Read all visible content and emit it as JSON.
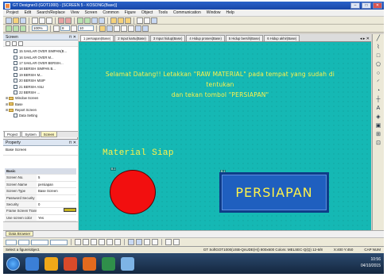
{
  "window": {
    "title": "GT Designer3 (GOT1000) - [SCREEN 5 - KOSONG(Base)]"
  },
  "menu": [
    "Project",
    "Edit",
    "Search/Replace",
    "View",
    "Screen",
    "Common",
    "Figure",
    "Object",
    "Tools",
    "Communication",
    "Window",
    "Help"
  ],
  "toolbar": {
    "zoom": "100%",
    "font_size": "8",
    "line_width": "10"
  },
  "screens_pane": {
    "title": "Screen",
    "items": [
      {
        "label": "15 SAKLAR OVER SIMPAN(B...",
        "type": "doc",
        "indent": 1
      },
      {
        "label": "16 SAKLAR OVER M...",
        "type": "doc",
        "indent": 1
      },
      {
        "label": "17 SAKLAR OVER BERSIH...",
        "type": "doc",
        "indent": 1
      },
      {
        "label": "18 BERSIH SIMPAN B...",
        "type": "doc",
        "indent": 1
      },
      {
        "label": "19 BERSIH M...",
        "type": "doc",
        "indent": 1
      },
      {
        "label": "20 BERSIH MSIP",
        "type": "doc",
        "indent": 1
      },
      {
        "label": "21 BERSIH ASLI",
        "type": "doc",
        "indent": 1
      },
      {
        "label": "22 BERSIH ...",
        "type": "doc",
        "indent": 1
      },
      {
        "label": "Window Screen",
        "type": "folder",
        "indent": 0
      },
      {
        "label": "Base",
        "type": "folder",
        "indent": 0
      },
      {
        "label": "Report Screen",
        "type": "folder",
        "indent": 0
      },
      {
        "label": "Data Setting",
        "type": "doc",
        "indent": 1
      }
    ],
    "tabs": [
      "Project",
      "System",
      "Screen"
    ]
  },
  "properties": {
    "title": "Property",
    "subject": "Base Screen",
    "rows": [
      {
        "key": "Basic",
        "value": "",
        "category": true
      },
      {
        "key": "Screen No.",
        "value": "5"
      },
      {
        "key": "Screen Name",
        "value": "persiapan"
      },
      {
        "key": "Screen Type",
        "value": "Base Screen"
      },
      {
        "key": "Password Security",
        "value": ""
      },
      {
        "key": "Security",
        "value": "0"
      },
      {
        "key": "Frame Screen Transition",
        "value": ""
      },
      {
        "key": "Use screen color",
        "value": "Yes"
      },
      {
        "key": "Pattern",
        "value": ""
      },
      {
        "key": "Pattern Color",
        "value": ""
      }
    ],
    "footer": "Data Browser"
  },
  "doc_tabs": [
    "1 persiapan(Base)",
    "2 Input kartu(Base)",
    "3 Input hidup(Base)",
    "4 Hidup proses(Base)",
    "5 Hidup bersih(Base)",
    "6 Hidup akhir(Base)"
  ],
  "canvas": {
    "background": "#15b8b4",
    "banner_line1": "Selamat Datang!! Letakkan \"RAW MATERIAL\" pada tempat yang sudah di tentukan",
    "banner_line2": "dan tekan tombol \"PERSIAPAN\"",
    "material_label": "Material Siap",
    "lamp_tag": "B-1",
    "button_tag": "B-1",
    "button_label": "PERSIAPAN",
    "accent_text_color": "#fff24a",
    "lamp_color": "#f20f0f",
    "button_color": "#1f5fbf"
  },
  "debug_strip": "Data Browser",
  "statusbar": {
    "left": "Select a figure/object.",
    "connection": "GT SoftGOT1000(USB-QnUDE(H)) 800x600 Colors: MELSEC-Q(Q) 12-6/8",
    "coords": "X:400 Y:450",
    "mode": "CAP NUM"
  },
  "taskbar": {
    "time": "10:56",
    "date": "04/10/2015"
  }
}
